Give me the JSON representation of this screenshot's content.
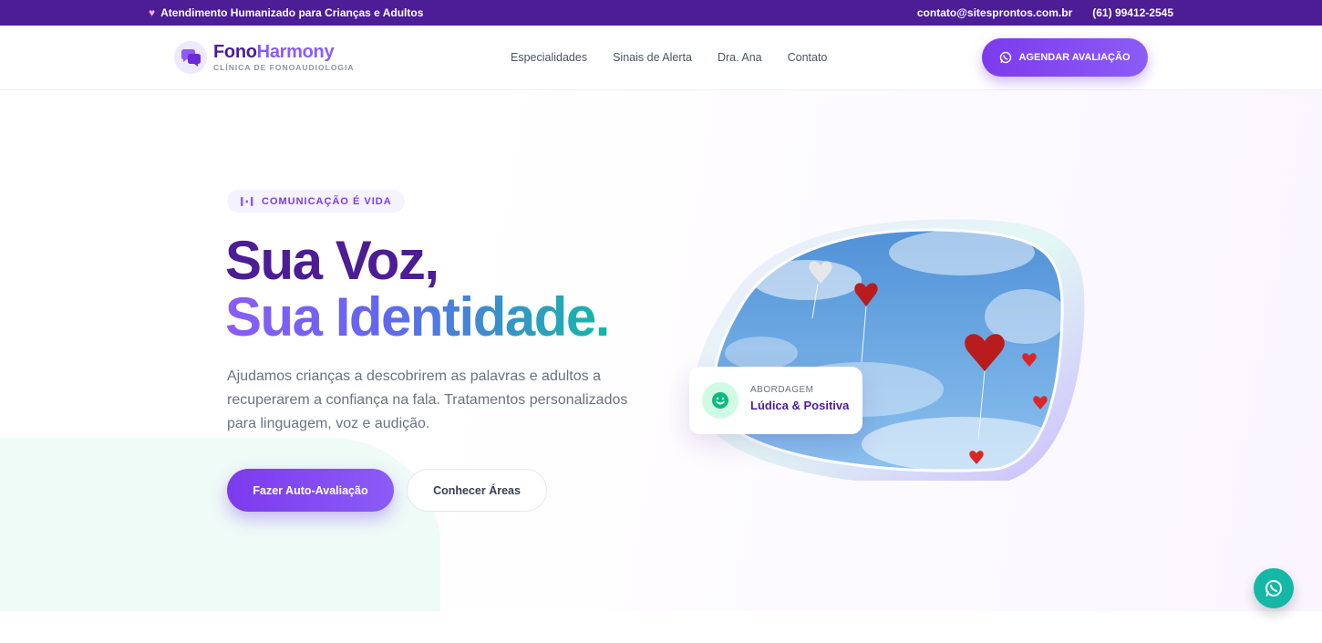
{
  "topbar": {
    "tagline": "Atendimento Humanizado para Crianças e Adultos",
    "email": "contato@sitesprontos.com.br",
    "phone": "(61) 99412-2545"
  },
  "brand": {
    "name_part1": "Fono",
    "name_part2": "Harmony",
    "subtitle": "CLÍNICA DE FONOAUDIOLOGIA"
  },
  "nav": {
    "items": [
      "Especialidades",
      "Sinais de Alerta",
      "Dra. Ana",
      "Contato"
    ],
    "cta_label": "AGENDAR AVALIAÇÃO"
  },
  "hero": {
    "pill": "COMUNICAÇÃO É VIDA",
    "title_line1": "Sua Voz,",
    "title_line2": "Sua Identidade.",
    "lead": "Ajudamos crianças a descobrirem as palavras e adultos a recuperarem a confiança na fala. Tratamentos personalizados para linguagem, voz e audição.",
    "primary_button": "Fazer Auto-Avaliação",
    "secondary_button": "Conhecer Áreas"
  },
  "badge_card": {
    "kicker": "ABORDAGEM",
    "value": "Lúdica & Positiva"
  },
  "colors": {
    "brand_dark": "#4c1d95",
    "brand_accent": "#8b5cf6",
    "teal": "#14b8a6"
  }
}
